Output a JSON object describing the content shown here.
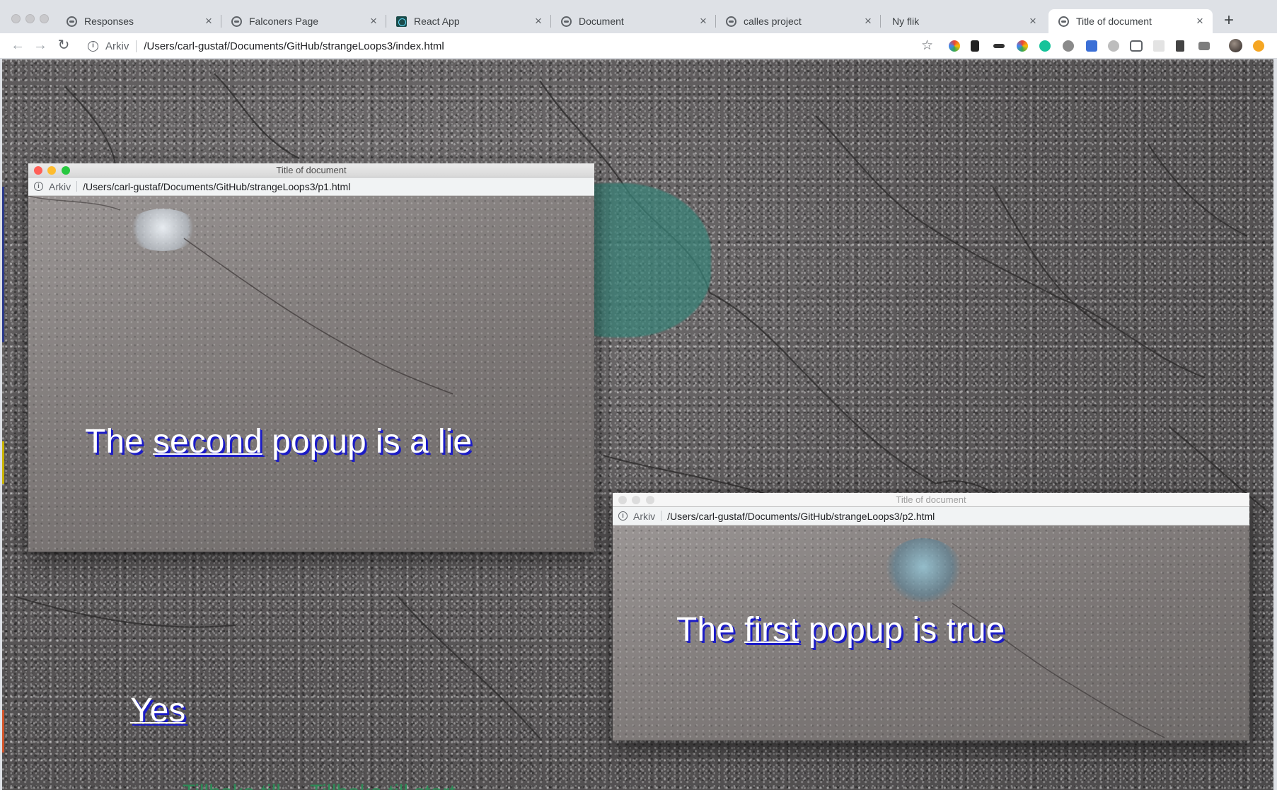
{
  "tabs": [
    {
      "title": "Responses",
      "favicon": "globe-icon"
    },
    {
      "title": "Falconers Page",
      "favicon": "globe-icon"
    },
    {
      "title": "React App",
      "favicon": "react-icon"
    },
    {
      "title": "Document",
      "favicon": "globe-icon"
    },
    {
      "title": "calles project",
      "favicon": "globe-icon"
    },
    {
      "title": "Ny flik",
      "favicon": "none"
    },
    {
      "title": "Title of document",
      "favicon": "globe-icon",
      "active": true
    }
  ],
  "toolbar": {
    "url_prefix": "Arkiv",
    "url": "/Users/carl-gustaf/Documents/GitHub/strangeLoops3/index.html"
  },
  "page": {
    "yes_link": "Yes",
    "bottom_partial_text": "Tillbaka till ...    Tillbaka till start"
  },
  "popup1": {
    "window_title": "Title of document",
    "url_prefix": "Arkiv",
    "url": "/Users/carl-gustaf/Documents/GitHub/strangeLoops3/p1.html",
    "text_before": "The ",
    "link": "second",
    "text_after": " popup is a lie"
  },
  "popup2": {
    "window_title": "Title of document",
    "url_prefix": "Arkiv",
    "url": "/Users/carl-gustaf/Documents/GitHub/strangeLoops3/p2.html",
    "text_before": "The ",
    "link": "first",
    "text_after": " popup is true"
  },
  "colors": {
    "text_shadow": "#1b1bc6",
    "close": "#ff5f57",
    "minimize": "#febc2e",
    "zoom": "#28c840"
  }
}
